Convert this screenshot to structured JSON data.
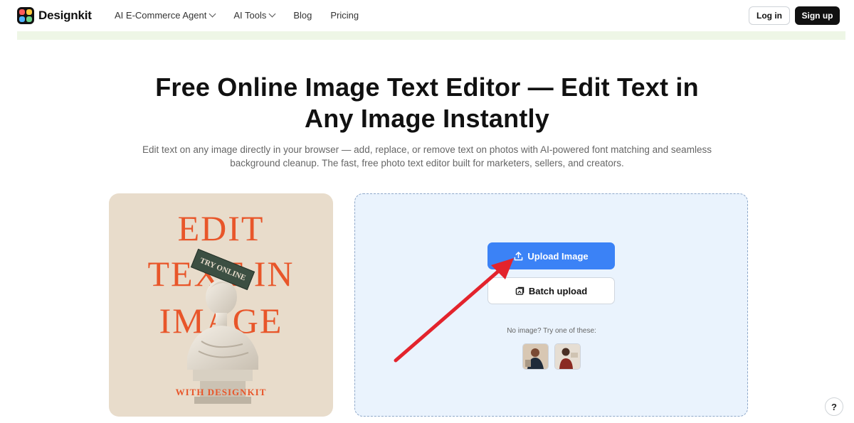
{
  "brand": {
    "name": "Designkit",
    "logo_colors": [
      "#ff5a5a",
      "#ffc93c",
      "#4fb3ff",
      "#6ad48a"
    ]
  },
  "nav": {
    "items": [
      {
        "label": "AI E-Commerce Agent",
        "has_dropdown": true
      },
      {
        "label": "AI Tools",
        "has_dropdown": true
      },
      {
        "label": "Blog",
        "has_dropdown": false
      },
      {
        "label": "Pricing",
        "has_dropdown": false
      }
    ],
    "login_label": "Log in",
    "signup_label": "Sign up"
  },
  "hero": {
    "title_line1": "Free Online Image Text Editor — Edit Text in",
    "title_line2": "Any Image Instantly",
    "subtitle_line1": "Edit text on any image directly in your browser — add, replace, or remove text on photos with AI-powered font matching and seamless",
    "subtitle_line2": "background cleanup. The fast, free photo text editor built for marketers, sellers, and creators."
  },
  "preview": {
    "line1": "EDIT",
    "line2": "TEXT IN",
    "line3": "IMAGE",
    "badge": "TRY ONLINE",
    "footer": "WITH DESIGNKIT",
    "accent_color": "#e8562a",
    "background_color": "#e8dccb"
  },
  "upload": {
    "upload_label": "Upload Image",
    "batch_label": "Batch upload",
    "try_text": "No image? Try one of these:",
    "accent_color": "#3b82f6"
  },
  "help": {
    "label": "?"
  }
}
